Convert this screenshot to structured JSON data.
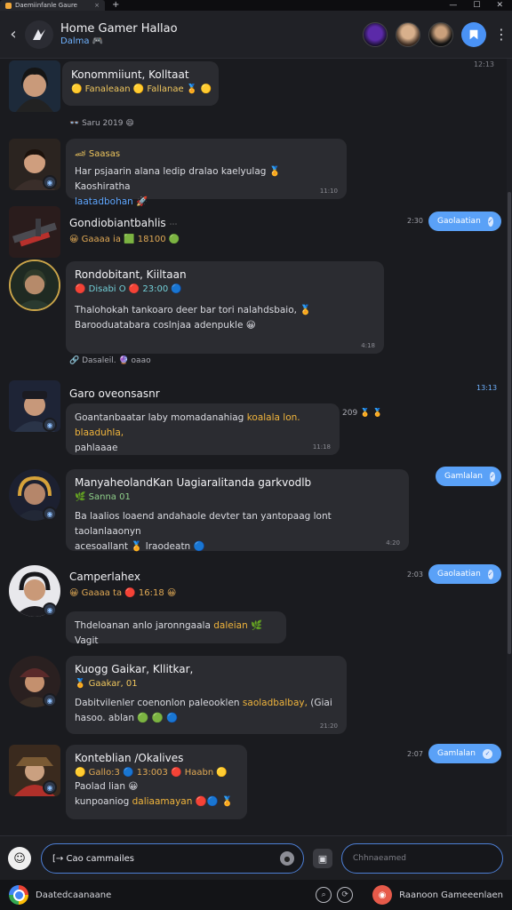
{
  "titlebar": {
    "tab_label": "Daemiinfanle Gaure",
    "tab_close": "×",
    "add": "+",
    "min": "—",
    "max": "☐",
    "close": "✕"
  },
  "header": {
    "back": "‹",
    "title": "Home Gamer Hallao",
    "subtitle": "Dalma 🎮",
    "kebab": "⋮"
  },
  "messages": {
    "m1": {
      "title": "Konommiiunt, Kolltaat",
      "meta": "🟡 Fanaleaan 🟡 Fallanae 🏅 🟡",
      "ext": "👓 Saru 2019 😄"
    },
    "m2": {
      "meta": "🏎 Saasas",
      "body_a": "Har psjaarin alana ledip dralao kaelyulag 🏅 Kaoshiratha",
      "body_link": "laatadbohan",
      "body_b": "🚀",
      "time": "11:10"
    },
    "m3": {
      "name": "Gondiobiantbahlis",
      "name_tail": "⋯",
      "meta": "😀 Gaaaa ia 🟩 18100 🟢",
      "pill": "Gaolaatian",
      "pill_time": "2:30"
    },
    "m4": {
      "title": "Rondobitant, Kiiltaan",
      "meta": "🔴 Disabi O 🔴 23:00 🔵",
      "body": "Thalohokah tankoaro deer bar tori nalahdsbaio, 🏅 Barooduatabara coslnjaa adenpukle 😀",
      "time": "4:18",
      "ext": "🔗 Dasaleil. 🔮 oaao"
    },
    "m5": {
      "name": "Garo oveonsasnr",
      "stamp": "13:13",
      "body_a": "Goantanbaatar laby momadanahiag",
      "body_hl": "koalala lon.",
      "body_hl2": "blaaduhla,",
      "body_b": "pahlaaae",
      "time": "11:18",
      "ext": "209 🏅 🏅"
    },
    "m6": {
      "title": "ManyaheolandKan Uagiaralitanda garkvodlb",
      "meta": "🌿 Sanna 01",
      "body_a": "Ba laalios loaend andahaole devter tan yantopaag lont taolanlaaonyn",
      "body_b": "acesoallant 🏅 lraodeatn 🔵",
      "time": "4:20",
      "pill": "Gamlalan"
    },
    "m7": {
      "name": "Camperlahex",
      "meta": "😀 Gaaaa ta 🔴 16:18 😀",
      "body_a": "Thdeloanan anlo jaronngaala",
      "body_hl": "daleian",
      "body_b": "🌿 Vagit",
      "pill": "Gaolaatian",
      "pill_time": "2:03"
    },
    "m8": {
      "title": "Kuogg Gaikar, Kllitkar,",
      "meta": "🏅 Gaakar, 01",
      "body_a": "Dabitvilenler coenonlon paleooklen",
      "body_hl": "saoladbalbay,",
      "body_b": "(Giai hasoo. ablan 🟢 🟢 🔵",
      "time": "21:20"
    },
    "m9": {
      "title": "Konteblian /Okalives",
      "meta": "🟡 Gallo:3 🔵 13:003 🔴 Haabn 🟡",
      "line1": "Paolad lian 😀",
      "body_a": "kunpoaniog",
      "body_hl": "daliaamayan",
      "body_b": "🔴🔵 🏅",
      "pill": "Gamlalan",
      "pill_time": "2:07"
    },
    "stamp_top": "12:13"
  },
  "composer": {
    "emoji": "☺",
    "input_value": "[→ Cao cammailes",
    "mic": "●",
    "attach": "▣",
    "side_placeholder": "Chhnaeamed"
  },
  "taskbar": {
    "left_label": "Daatedcaanaane",
    "right_label": "Raanoon Gameeenlaen",
    "btn1": "⌕",
    "btn2": "⟳",
    "app": "◉"
  }
}
